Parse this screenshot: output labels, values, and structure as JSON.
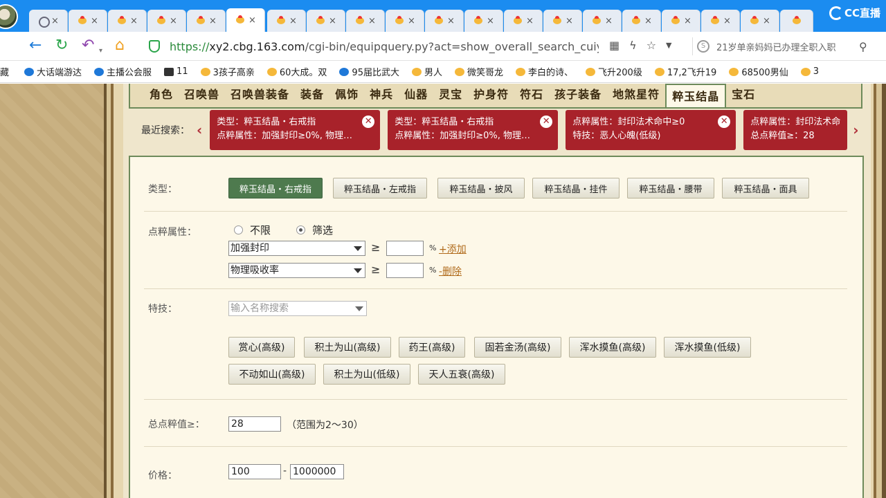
{
  "browser": {
    "tabs": [
      {
        "icon": "globe-icon",
        "active": false
      },
      {
        "icon": "game-favicon-icon",
        "active": false
      },
      {
        "icon": "game-favicon-icon",
        "active": false
      },
      {
        "icon": "game-favicon-icon",
        "active": false
      },
      {
        "icon": "game-favicon-icon",
        "active": false
      },
      {
        "icon": "game-favicon-icon",
        "active": true
      },
      {
        "icon": "game-favicon-icon",
        "active": false
      },
      {
        "icon": "game-favicon-icon",
        "active": false
      },
      {
        "icon": "game-favicon-icon",
        "active": false
      },
      {
        "icon": "game-favicon-icon",
        "active": false
      },
      {
        "icon": "game-favicon-icon",
        "active": false
      },
      {
        "icon": "game-favicon-icon",
        "active": false
      },
      {
        "icon": "game-favicon-icon",
        "active": false
      },
      {
        "icon": "game-favicon-icon",
        "active": false
      },
      {
        "icon": "game-favicon-icon",
        "active": false
      },
      {
        "icon": "game-favicon-icon",
        "active": false
      },
      {
        "icon": "game-favicon-icon",
        "active": false
      },
      {
        "icon": "game-favicon-icon",
        "active": false
      },
      {
        "icon": "game-favicon-icon",
        "active": false
      },
      {
        "icon": "game-favicon-icon",
        "active": false
      },
      {
        "icon": "game-favicon-icon",
        "active": false
      }
    ],
    "tab_close": "×",
    "watermark": "CC直播",
    "url_scheme": "https://",
    "url_host": "xy2.cbg.163.com",
    "url_path": "/cgi-bin/equipquery.py?act=show_overall_search_cuiyu_j",
    "search_text": "21岁单亲妈妈已办理全职入职",
    "bookmarks": [
      "藏",
      "大话端游达",
      "主播公会服",
      "11",
      "3孩子高亲",
      "60大成。双",
      "95届比武大",
      "男人",
      "微笑哥龙",
      "李白的诗、",
      "飞升200级",
      "17,2飞升19",
      "68500男仙",
      "3"
    ]
  },
  "categories": [
    "角色",
    "召唤兽",
    "召唤兽装备",
    "装备",
    "佩饰",
    "神兵",
    "仙器",
    "灵宝",
    "护身符",
    "符石",
    "孩子装备",
    "地煞星符",
    "粹玉结晶",
    "宝石"
  ],
  "active_category": "粹玉结晶",
  "recent": {
    "label": "最近搜索：",
    "chips": [
      {
        "line1": "类型：粹玉结晶・右戒指",
        "line2": "点粹属性：加强封印≥0%, 物理…"
      },
      {
        "line1": "类型：粹玉结晶・右戒指",
        "line2": "点粹属性：加强封印≥0%, 物理…"
      },
      {
        "line1": "点粹属性：封印法术命中≥0",
        "line2": "特技：恶人心魄(低级)"
      },
      {
        "line1": "点粹属性：封印法术命",
        "line2": "总点粹值≥：28"
      }
    ]
  },
  "form": {
    "type_label": "类型：",
    "types": [
      "粹玉结晶・右戒指",
      "粹玉结晶・左戒指",
      "粹玉结晶・披风",
      "粹玉结晶・挂件",
      "粹玉结晶・腰带",
      "粹玉结晶・面具"
    ],
    "active_type": "粹玉结晶・右戒指",
    "attr_label": "点粹属性：",
    "radio_none": "不限",
    "radio_filter": "筛选",
    "attr_rows": [
      {
        "select": "加强封印",
        "op": "≥",
        "value": "",
        "unit": "%",
        "action": "+添加"
      },
      {
        "select": "物理吸收率",
        "op": "≥",
        "value": "",
        "unit": "%",
        "action": "-删除"
      }
    ],
    "skill_label": "特技：",
    "skill_placeholder": "输入名称搜索",
    "skills": [
      "赏心(高级)",
      "积土为山(高级)",
      "药王(高级)",
      "固若金汤(高级)",
      "浑水摸鱼(高级)",
      "浑水摸鱼(低级)",
      "不动如山(高级)",
      "积土为山(低级)",
      "天人五衰(高级)"
    ],
    "total_label": "总点粹值≥：",
    "total_value": "28",
    "total_hint": "（范围为2～30）",
    "price_label": "价格：",
    "price_min": "100",
    "price_dash": "-",
    "price_max": "1000000"
  }
}
